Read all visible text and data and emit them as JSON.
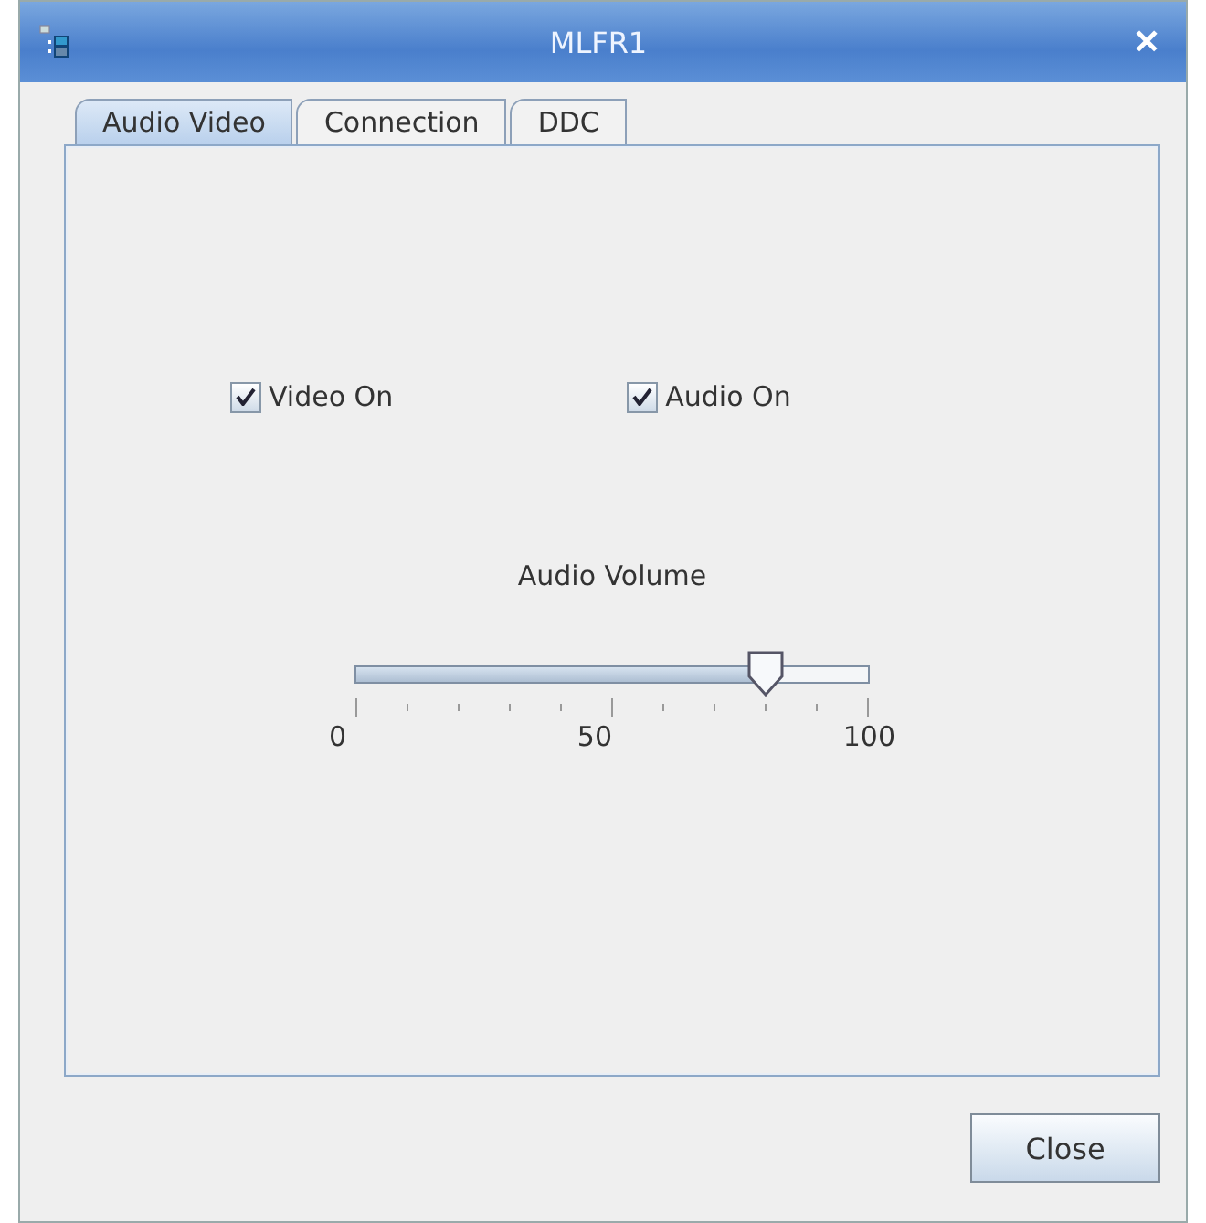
{
  "window": {
    "title": "MLFR1",
    "close": "✕"
  },
  "tabs": [
    {
      "label": "Audio Video",
      "selected": true
    },
    {
      "label": "Connection",
      "selected": false
    },
    {
      "label": "DDC",
      "selected": false
    }
  ],
  "checkboxes": [
    {
      "label": "Video On",
      "checked": true
    },
    {
      "label": "Audio On",
      "checked": true
    }
  ],
  "volume": {
    "label": "Audio Volume",
    "level": 0.8,
    "tick_labels": [
      "0",
      "50",
      "100"
    ]
  },
  "buttons": [
    "Close"
  ]
}
